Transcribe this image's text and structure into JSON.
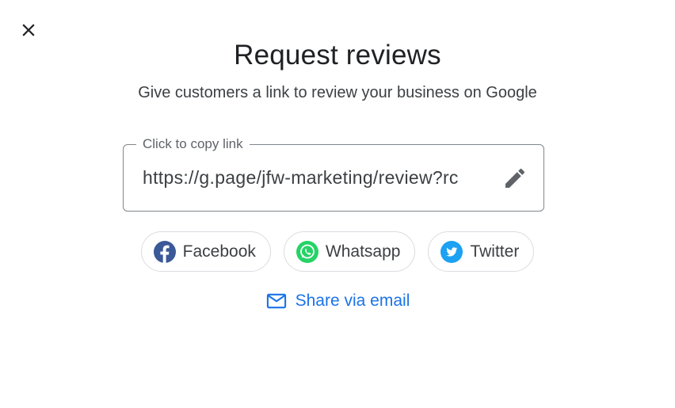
{
  "dialog": {
    "close_icon": "close-icon",
    "title": "Request reviews",
    "subtitle": "Give customers a link to review your business on Google"
  },
  "link_field": {
    "label": "Click to copy link",
    "value": "https://g.page/jfw-marketing/review?rc",
    "edit_icon": "pencil-icon"
  },
  "share": {
    "buttons": [
      {
        "label": "Facebook",
        "icon": "facebook-icon",
        "color": "#3b5998"
      },
      {
        "label": "Whatsapp",
        "icon": "whatsapp-icon",
        "color": "#25d366"
      },
      {
        "label": "Twitter",
        "icon": "twitter-icon",
        "color": "#1da1f2"
      }
    ],
    "email": {
      "label": "Share via email",
      "icon": "mail-icon",
      "color": "#1a73e8"
    }
  }
}
